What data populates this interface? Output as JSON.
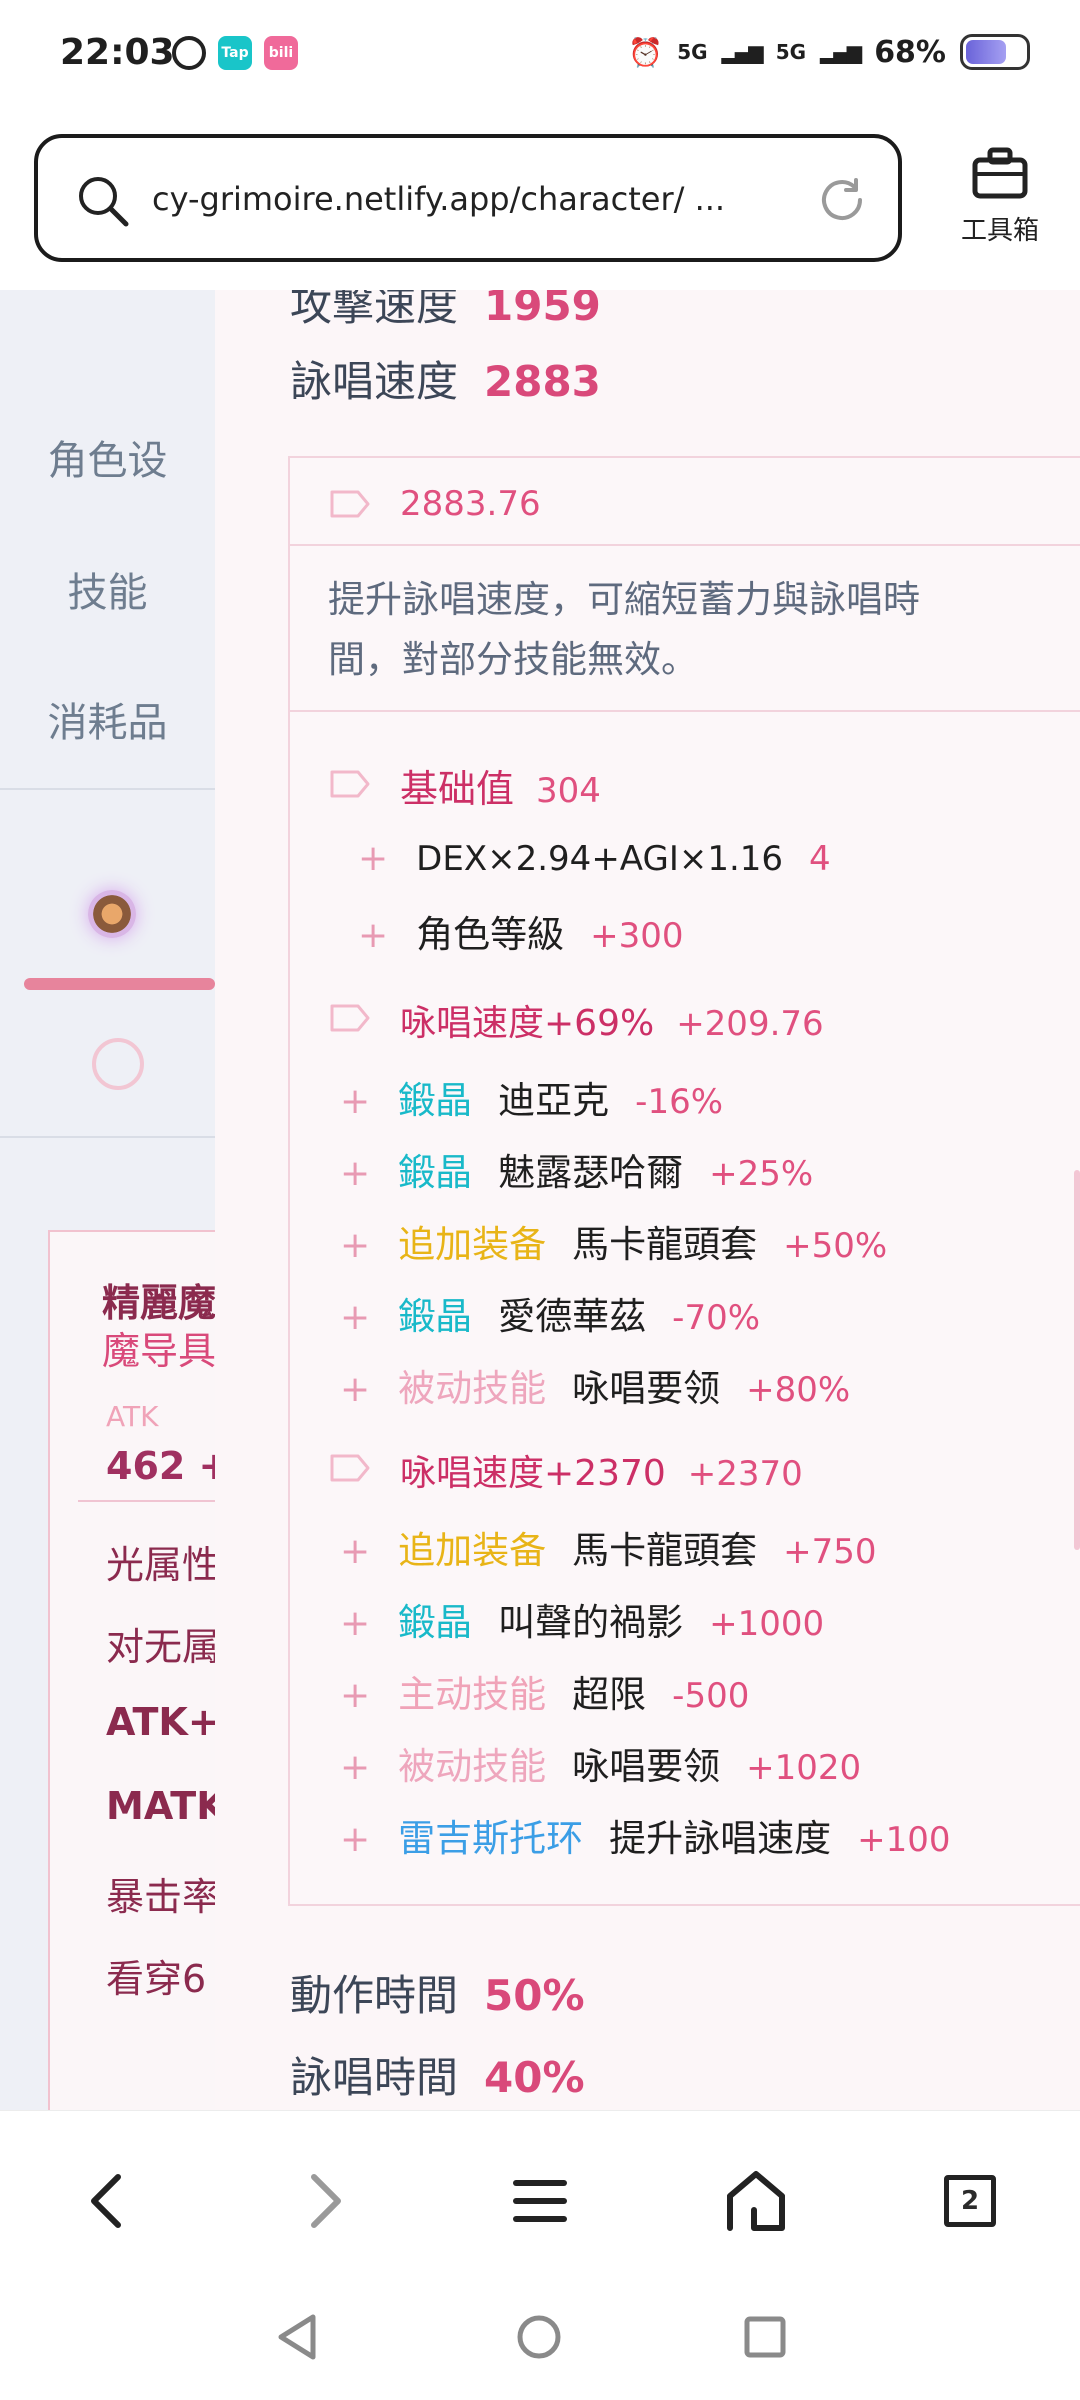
{
  "status_bar": {
    "time": "22:03",
    "app_icons": [
      "Tap",
      "bili"
    ],
    "signal_1": "5G",
    "signal_2": "5G",
    "battery_pct": "68%",
    "battery_level": 0.68
  },
  "browser": {
    "url": "cy-grimoire.netlify.app/character/ ...",
    "toolbox_label": "工具箱"
  },
  "sidebar": {
    "items": [
      "角色设",
      "技能",
      "消耗品"
    ]
  },
  "card_peek": {
    "title": "精麗魔",
    "subtitle": "魔导具",
    "atk_label": "ATK",
    "atk_value": "462 +",
    "stats": [
      "光属性",
      "对无属",
      "ATK+",
      "MATK",
      "暴击率",
      "看穿6"
    ]
  },
  "panel": {
    "stats_top": [
      {
        "label": "攻撃速度",
        "value": "1959"
      },
      {
        "label": "詠唱速度",
        "value": "2883"
      }
    ],
    "detail": {
      "total": "2883.76",
      "description": [
        "提升詠唱速度，可縮短蓄力與詠唱時",
        "間，對部分技能無效。"
      ],
      "groups": [
        {
          "label": "基础值",
          "value": "304",
          "lines": [
            {
              "source": "",
              "name": "DEX×2.94+AGI×1.16",
              "amount": "4"
            },
            {
              "source": "",
              "name": "角色等級",
              "amount": "+300"
            }
          ]
        },
        {
          "label": "咏唱速度+69%",
          "value": "+209.76",
          "lines": [
            {
              "source": "鍛晶",
              "source_color": "#19b9c9",
              "name": "迪亞克",
              "amount": "-16%"
            },
            {
              "source": "鍛晶",
              "source_color": "#19b9c9",
              "name": "魅露瑟哈爾",
              "amount": "+25%"
            },
            {
              "source": "追加装备",
              "source_color": "#e8b417",
              "name": "馬卡龍頭套",
              "amount": "+50%"
            },
            {
              "source": "鍛晶",
              "source_color": "#19b9c9",
              "name": "愛德華茲",
              "amount": "-70%"
            },
            {
              "source": "被动技能",
              "source_color": "#eea6bd",
              "name": "咏唱要领",
              "amount": "+80%"
            }
          ]
        },
        {
          "label": "咏唱速度+2370",
          "value": "+2370",
          "lines": [
            {
              "source": "追加装备",
              "source_color": "#e8b417",
              "name": "馬卡龍頭套",
              "amount": "+750"
            },
            {
              "source": "鍛晶",
              "source_color": "#19b9c9",
              "name": "叫聲的禍影",
              "amount": "+1000"
            },
            {
              "source": "主动技能",
              "source_color": "#f0a3b8",
              "name": "超限",
              "amount": "-500"
            },
            {
              "source": "被动技能",
              "source_color": "#eea6bd",
              "name": "咏唱要领",
              "amount": "+1020"
            },
            {
              "source": "雷吉斯托环",
              "source_color": "#3b9ee6",
              "name": "提升詠唱速度",
              "amount": "+100"
            }
          ]
        }
      ]
    },
    "stats_bottom": [
      {
        "label": "動作時間",
        "value": "50%"
      },
      {
        "label": "詠唱時間",
        "value": "40%"
      }
    ]
  },
  "bottom_nav": {
    "tabs_count": "2"
  }
}
